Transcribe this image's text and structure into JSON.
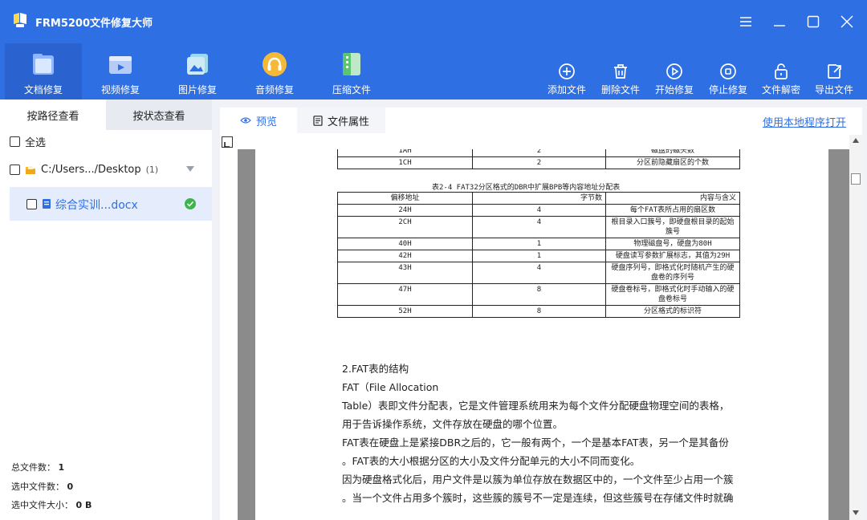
{
  "app": {
    "title": "FRM5200文件修复大师"
  },
  "window_controls": [
    "menu-icon",
    "minimize-icon",
    "maximize-icon",
    "close-icon"
  ],
  "mode_tabs": [
    {
      "label": "文档修复",
      "icon": "document-icon",
      "active": true
    },
    {
      "label": "视频修复",
      "icon": "video-icon",
      "active": false
    },
    {
      "label": "图片修复",
      "icon": "image-icon",
      "active": false
    },
    {
      "label": "音频修复",
      "icon": "audio-icon",
      "active": false
    },
    {
      "label": "压缩文件",
      "icon": "archive-icon",
      "active": false
    }
  ],
  "actions": [
    {
      "label": "添加文件",
      "icon": "add-icon"
    },
    {
      "label": "删除文件",
      "icon": "trash-icon"
    },
    {
      "label": "开始修复",
      "icon": "play-icon"
    },
    {
      "label": "停止修复",
      "icon": "stop-icon"
    },
    {
      "label": "文件解密",
      "icon": "unlock-icon"
    },
    {
      "label": "导出文件",
      "icon": "export-icon"
    }
  ],
  "sidebar": {
    "tabs": [
      "按路径查看",
      "按状态查看"
    ],
    "select_all": "全选",
    "folder": {
      "path": "C:/Users.../Desktop",
      "count": "(1)"
    },
    "file": {
      "name": "综合实训...docx",
      "status": "ok"
    },
    "stats": {
      "total_label": "总文件数：",
      "total_value": "1",
      "selected_label": "选中文件数：",
      "selected_value": "0",
      "size_label": "选中文件大小：",
      "size_value": "0 B"
    }
  },
  "content": {
    "tabs": [
      "预览",
      "文件属性"
    ],
    "open_link": "使用本地程序打开"
  },
  "document": {
    "top_rows": [
      [
        "1AH",
        "2",
        "磁盘的磁头数"
      ],
      [
        "1CH",
        "2",
        "分区前隐藏扇区的个数"
      ]
    ],
    "table_caption": "表2-4  FAT32分区格式的DBR中扩展BPB等内容地址分配表",
    "headers": [
      "偏移地址",
      "字节数",
      "内容与含义"
    ],
    "rows": [
      [
        "24H",
        "4",
        "每个FAT表所占用的扇区数"
      ],
      [
        "2CH",
        "4",
        "根目录入口簇号，即硬盘根目录的起始簇号"
      ],
      [
        "40H",
        "1",
        "物理磁盘号，硬盘为80H"
      ],
      [
        "42H",
        "1",
        "硬盘读写参数扩展标志，其值为29H"
      ],
      [
        "43H",
        "4",
        "硬盘序列号，即格式化时随机产生的硬盘卷的序列号"
      ],
      [
        "47H",
        "8",
        "硬盘卷标号，即格式化时手动输入的硬盘卷标号"
      ],
      [
        "52H",
        "8",
        "分区格式的标识符"
      ]
    ],
    "paragraphs": [
      "2.FAT表的结构",
      "FAT（File Allocation",
      "Table）表即文件分配表，它是文件管理系统用来为每个文件分配硬盘物理空间的表格，",
      "用于告诉操作系统，文件存放在硬盘的哪个位置。",
      "FAT表在硬盘上是紧接DBR之后的，它一般有两个，一个是基本FAT表，另一个是其备份",
      "。FAT表的大小根据分区的大小及文件分配单元的大小不同而变化。",
      "因为硬盘格式化后，用户文件是以簇为单位存放在数据区中的，一个文件至少占用一个簇",
      "。当一个文件占用多个簇时，这些簇的簇号不一定是连续，但这些簇号在存储文件时就确"
    ]
  },
  "colors": {
    "brand_blue": "#2f6fe4",
    "status_green": "#3cb54a",
    "link_blue": "#2f6fe4"
  }
}
